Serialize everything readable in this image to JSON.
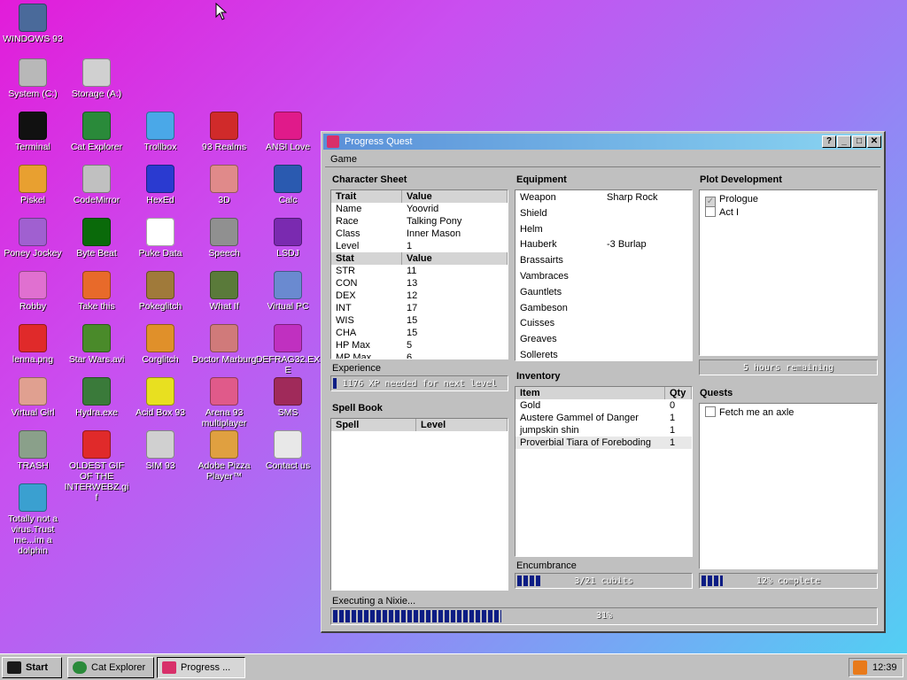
{
  "desktop": {
    "icons": [
      {
        "label": "WINDOWS 93",
        "icon": "computer-icon",
        "color": "#4a6a9a"
      },
      {
        "label": "System (C:)",
        "icon": "drive-icon",
        "color": "#b8b8b8"
      },
      {
        "label": "Storage (A:)",
        "icon": "floppy-icon",
        "color": "#d0d0d0"
      },
      {
        "label": "Terminal",
        "icon": "terminal-icon",
        "color": "#111111"
      },
      {
        "label": "Cat Explorer",
        "icon": "globe-icon",
        "color": "#2a8a3a"
      },
      {
        "label": "Trollbox",
        "icon": "chat-icon",
        "color": "#4aa8e8"
      },
      {
        "label": "93 Realms",
        "icon": "realms-icon",
        "color": "#d02a2a"
      },
      {
        "label": "ANSI Love",
        "icon": "ansi-icon",
        "color": "#e01a8a"
      },
      {
        "label": "Piskel",
        "icon": "palette-icon",
        "color": "#e8a030"
      },
      {
        "label": "CodeMirror",
        "icon": "codemirror-icon",
        "color": "#c0c0c0"
      },
      {
        "label": "HexEd",
        "icon": "cube-icon",
        "color": "#2a3ad0"
      },
      {
        "label": "3D",
        "icon": "teapot-icon",
        "color": "#e08a8a"
      },
      {
        "label": "Calc",
        "icon": "calculator-icon",
        "color": "#2a5ab0"
      },
      {
        "label": "Poney Jockey",
        "icon": "pony-icon",
        "color": "#a060d0"
      },
      {
        "label": "Byte Beat",
        "icon": "bytebeat-icon",
        "color": "#0a6a0a"
      },
      {
        "label": "Puke Data",
        "icon": "pd-icon",
        "color": "#ffffff"
      },
      {
        "label": "Speech",
        "icon": "speech-icon",
        "color": "#909090"
      },
      {
        "label": "LSDJ",
        "icon": "lsdj-icon",
        "color": "#7a2ab0"
      },
      {
        "label": "Robby",
        "icon": "robot-icon",
        "color": "#e070d0"
      },
      {
        "label": "Take this",
        "icon": "pixel-man-icon",
        "color": "#e86a2a"
      },
      {
        "label": "Pokeglitch",
        "icon": "pokeglitch-icon",
        "color": "#a07a3a"
      },
      {
        "label": "What If",
        "icon": "whatif-icon",
        "color": "#5a7a3a"
      },
      {
        "label": "Virtual PC",
        "icon": "virtual-pc-icon",
        "color": "#6a8ad0"
      },
      {
        "label": "lenna.png",
        "icon": "image-file-icon",
        "color": "#e02a2a"
      },
      {
        "label": "Star Wars.avi",
        "icon": "yoda-icon",
        "color": "#4a8a2a"
      },
      {
        "label": "Corglitch",
        "icon": "corgi-icon",
        "color": "#e0902a"
      },
      {
        "label": "Doctor Marburg",
        "icon": "doctor-icon",
        "color": "#d07a7a"
      },
      {
        "label": "DEFRAG32.EXE",
        "icon": "defrag-icon",
        "color": "#c030c0"
      },
      {
        "label": "Virtual Girl",
        "icon": "face-icon",
        "color": "#e0a090"
      },
      {
        "label": "Hydra.exe",
        "icon": "hydra-icon",
        "color": "#3a7a3a"
      },
      {
        "label": "Acid Box 93",
        "icon": "smiley-icon",
        "color": "#e8e020"
      },
      {
        "label": "Arena 93 multiplayer",
        "icon": "arena-cube-icon",
        "color": "#e05a8a"
      },
      {
        "label": "SMS",
        "icon": "sms-icon",
        "color": "#a02a5a"
      },
      {
        "label": "TRASH",
        "icon": "trash-icon",
        "color": "#8aa08a"
      },
      {
        "label": "OLDEST GIF OF THE INTERWEBZ.gif",
        "icon": "gif-file-icon",
        "color": "#e02a2a"
      },
      {
        "label": "SIM 93",
        "icon": "book-icon",
        "color": "#d0d0d0"
      },
      {
        "label": "Adobe Pizza Player™",
        "icon": "pizza-icon",
        "color": "#e0a040"
      },
      {
        "label": "Contact us",
        "icon": "contact-icon",
        "color": "#e8e8e8"
      },
      {
        "label": "Totally not a virus.Trust me...im a dolphin",
        "icon": "dolphin-icon",
        "color": "#3aa0d0"
      }
    ]
  },
  "window": {
    "title": "Progress Quest",
    "buttons": {
      "help": "?",
      "minimize": "_",
      "maximize": "□",
      "close": "✕"
    },
    "menu": {
      "game": "Game"
    },
    "character_sheet": {
      "title": "Character Sheet",
      "trait_header": {
        "col1": "Trait",
        "col2": "Value"
      },
      "traits": [
        {
          "name": "Name",
          "value": "Yoovrid"
        },
        {
          "name": "Race",
          "value": "Talking Pony"
        },
        {
          "name": "Class",
          "value": "Inner Mason"
        },
        {
          "name": "Level",
          "value": "1"
        }
      ],
      "stat_header": {
        "col1": "Stat",
        "col2": "Value"
      },
      "stats": [
        {
          "name": "STR",
          "value": "11"
        },
        {
          "name": "CON",
          "value": "13"
        },
        {
          "name": "DEX",
          "value": "12"
        },
        {
          "name": "INT",
          "value": "17"
        },
        {
          "name": "WIS",
          "value": "15"
        },
        {
          "name": "CHA",
          "value": "15"
        },
        {
          "name": "HP Max",
          "value": "5"
        },
        {
          "name": "MP Max",
          "value": "6"
        }
      ],
      "experience_label": "Experience",
      "experience_text": "1176 XP needed for next level",
      "experience_progress": 0.02
    },
    "spell_book": {
      "title": "Spell Book",
      "header": {
        "col1": "Spell",
        "col2": "Level"
      }
    },
    "equipment": {
      "title": "Equipment",
      "items": [
        {
          "slot": "Weapon",
          "item": "Sharp Rock"
        },
        {
          "slot": "Shield",
          "item": ""
        },
        {
          "slot": "Helm",
          "item": ""
        },
        {
          "slot": "Hauberk",
          "item": "-3 Burlap"
        },
        {
          "slot": "Brassairts",
          "item": ""
        },
        {
          "slot": "Vambraces",
          "item": ""
        },
        {
          "slot": "Gauntlets",
          "item": ""
        },
        {
          "slot": "Gambeson",
          "item": ""
        },
        {
          "slot": "Cuisses",
          "item": ""
        },
        {
          "slot": "Greaves",
          "item": ""
        },
        {
          "slot": "Sollerets",
          "item": ""
        }
      ]
    },
    "inventory": {
      "title": "Inventory",
      "header": {
        "col1": "Item",
        "col2": "Qty"
      },
      "items": [
        {
          "name": "Gold",
          "qty": "0"
        },
        {
          "name": "Austere Gammel of Danger",
          "qty": "1"
        },
        {
          "name": "jumpskin shin",
          "qty": "1"
        },
        {
          "name": "Proverbial Tiara of Foreboding",
          "qty": "1"
        }
      ],
      "encumbrance_label": "Encumbrance",
      "encumbrance_text": "3/21 cubits",
      "encumbrance_progress": 0.143
    },
    "plot": {
      "title": "Plot Development",
      "acts": [
        {
          "label": "Prologue",
          "checked": true
        },
        {
          "label": "Act I",
          "checked": false
        }
      ],
      "remaining_text": "5 hours remaining",
      "remaining_progress": 0.0
    },
    "quests": {
      "title": "Quests",
      "items": [
        {
          "label": "Fetch me an axle",
          "checked": false
        }
      ],
      "complete_text": "12% complete",
      "complete_progress": 0.12
    },
    "task": {
      "label": "Executing a Nixie...",
      "progress_text": "31%",
      "progress": 0.31
    }
  },
  "taskbar": {
    "start": "Start",
    "tasks": [
      {
        "label": "Cat Explorer",
        "pressed": false
      },
      {
        "label": "Progress ...",
        "pressed": true
      }
    ],
    "clock": "12:39"
  }
}
